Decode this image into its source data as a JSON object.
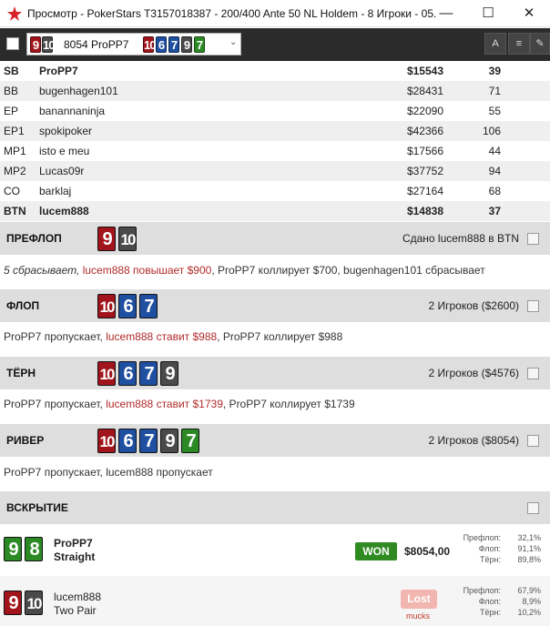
{
  "window": {
    "title": "Просмотр - PokerStars T3157018387 - 200/400 Ante 50 NL Holdem - 8 Игроки - 05...",
    "minimize": "—",
    "maximize": "☐",
    "close": "✕"
  },
  "toolbar": {
    "hand_select": {
      "value": "8054 ProPP7",
      "hole_cards": [
        {
          "rank": "9",
          "color": "red"
        },
        {
          "rank": "10",
          "color": "gray"
        }
      ],
      "board_cards": [
        {
          "rank": "10",
          "color": "red"
        },
        {
          "rank": "6",
          "color": "blue"
        },
        {
          "rank": "7",
          "color": "blue"
        },
        {
          "rank": "9",
          "color": "gray"
        },
        {
          "rank": "7",
          "color": "green"
        }
      ],
      "chevron": "⌄"
    },
    "font_button": "A",
    "list_button": "≡",
    "edit_button": "✎"
  },
  "players": [
    {
      "pos": "SB",
      "name": "ProPP7",
      "stack": "$15543",
      "bb": "39",
      "bold": true
    },
    {
      "pos": "BB",
      "name": "bugenhagen101",
      "stack": "$28431",
      "bb": "71",
      "bold": false
    },
    {
      "pos": "EP",
      "name": "banannaninja",
      "stack": "$22090",
      "bb": "55",
      "bold": false
    },
    {
      "pos": "EP1",
      "name": "spokipoker",
      "stack": "$42366",
      "bb": "106",
      "bold": false
    },
    {
      "pos": "MP1",
      "name": "isto e meu",
      "stack": "$17566",
      "bb": "44",
      "bold": false
    },
    {
      "pos": "MP2",
      "name": "Lucas09r",
      "stack": "$37752",
      "bb": "94",
      "bold": false
    },
    {
      "pos": "CO",
      "name": "barklaj",
      "stack": "$27164",
      "bb": "68",
      "bold": false
    },
    {
      "pos": "BTN",
      "name": "lucem888",
      "stack": "$14838",
      "bb": "37",
      "bold": true
    }
  ],
  "streets": {
    "preflop": {
      "name": "ПРЕФЛОП",
      "info": "Сдано lucem888 в BTN",
      "cards": [
        {
          "rank": "9",
          "color": "red"
        },
        {
          "rank": "10",
          "color": "gray"
        }
      ],
      "actions": {
        "a1": "5 сбрасывает, ",
        "a2": "lucem888 повышает $900",
        "a3": ", ProPP7 коллирует $700, bugenhagen101 сбрасывает"
      }
    },
    "flop": {
      "name": "ФЛОП",
      "info": "2 Игроков ($2600)",
      "cards": [
        {
          "rank": "10",
          "color": "red"
        },
        {
          "rank": "6",
          "color": "blue"
        },
        {
          "rank": "7",
          "color": "blue"
        }
      ],
      "actions": {
        "a1": "ProPP7 пропускает, ",
        "a2": "lucem888 ставит $988",
        "a3": ", ProPP7 коллирует $988"
      }
    },
    "turn": {
      "name": "ТЁРН",
      "info": "2 Игроков ($4576)",
      "cards": [
        {
          "rank": "10",
          "color": "red"
        },
        {
          "rank": "6",
          "color": "blue"
        },
        {
          "rank": "7",
          "color": "blue"
        },
        {
          "rank": "9",
          "color": "gray"
        }
      ],
      "actions": {
        "a1": "ProPP7 пропускает, ",
        "a2": "lucem888 ставит $1739",
        "a3": ", ProPP7 коллирует $1739"
      }
    },
    "river": {
      "name": "РИВЕР",
      "info": "2 Игроков ($8054)",
      "cards": [
        {
          "rank": "10",
          "color": "red"
        },
        {
          "rank": "6",
          "color": "blue"
        },
        {
          "rank": "7",
          "color": "blue"
        },
        {
          "rank": "9",
          "color": "gray"
        },
        {
          "rank": "7",
          "color": "green"
        }
      ],
      "actions": {
        "a1": "ProPP7 пропускает, lucem888 пропускает"
      }
    },
    "showdown": {
      "name": "ВСКРЫТИЕ"
    }
  },
  "showdown": [
    {
      "name": "ProPP7",
      "hand": "Straight",
      "cards": [
        {
          "rank": "9",
          "color": "green"
        },
        {
          "rank": "8",
          "color": "green"
        }
      ],
      "result": "WON",
      "amount": "$8054,00",
      "equity": [
        {
          "label": "Префлоп:",
          "value": "32,1%"
        },
        {
          "label": "Флоп:",
          "value": "91,1%"
        },
        {
          "label": "Тёрн:",
          "value": "89,8%"
        }
      ]
    },
    {
      "name": "lucem888",
      "hand": "Two Pair",
      "cards": [
        {
          "rank": "9",
          "color": "red"
        },
        {
          "rank": "10",
          "color": "gray"
        }
      ],
      "result": "Lost",
      "mucks": "mucks",
      "equity": [
        {
          "label": "Префлоп:",
          "value": "67,9%"
        },
        {
          "label": "Флоп:",
          "value": "8,9%"
        },
        {
          "label": "Тёрн:",
          "value": "10,2%"
        }
      ]
    }
  ],
  "colors": {
    "card_red": "#a1141b",
    "card_gray": "#4a4a4a",
    "card_blue": "#1f4fa0",
    "card_green": "#2c8a24",
    "hero_action": "#b02a2a",
    "won_badge": "#2f8a22",
    "lost_badge": "#f2b6b0"
  }
}
